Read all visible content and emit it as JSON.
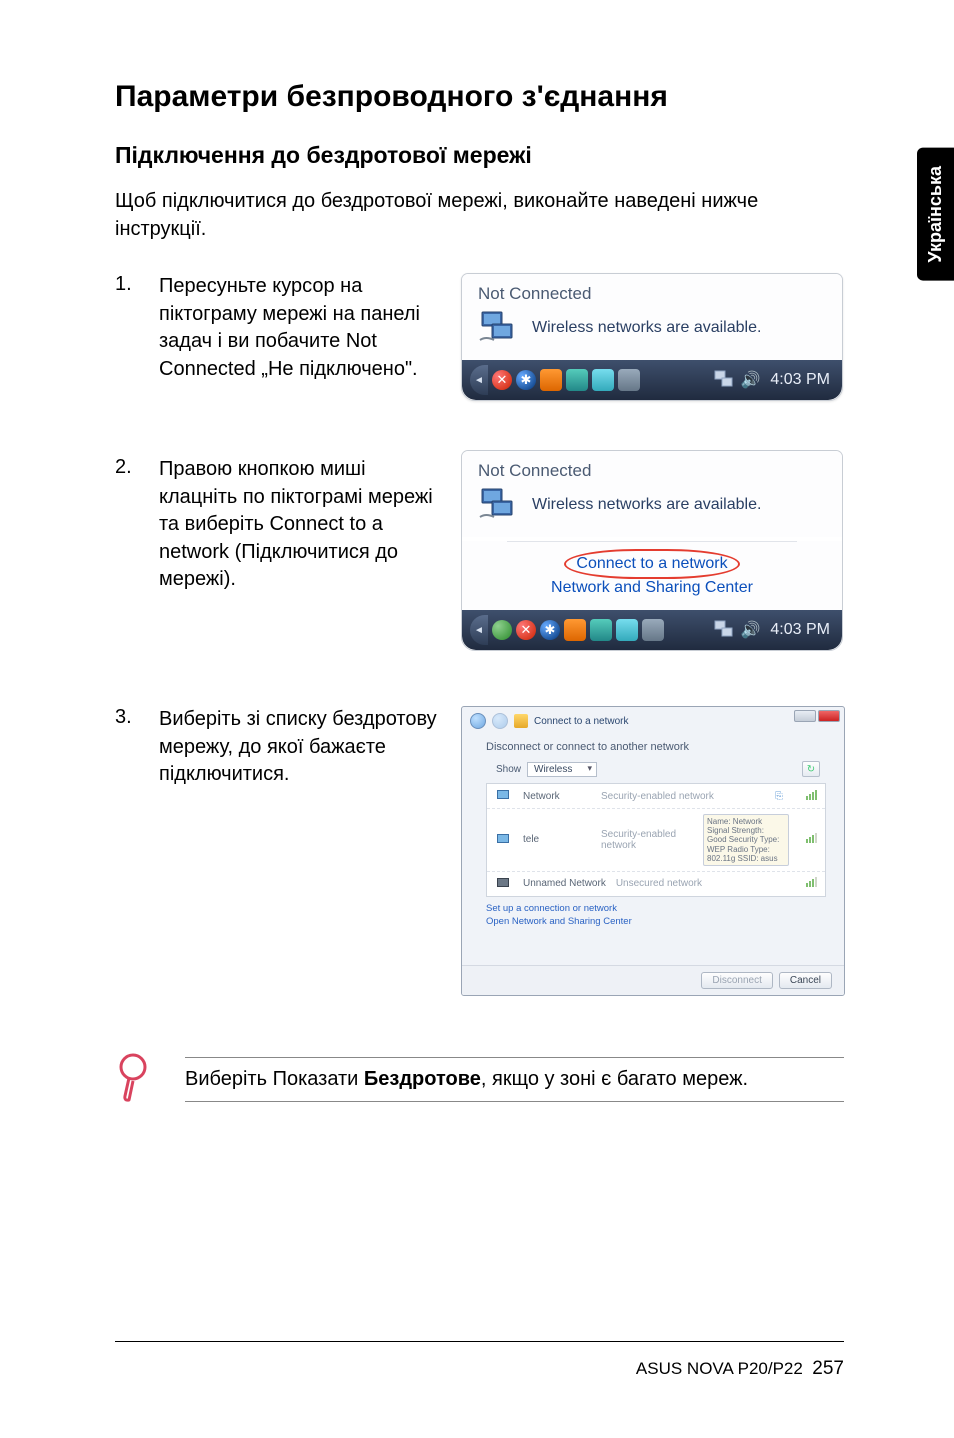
{
  "side_tab": "Українська",
  "heading": "Параметри безпроводного з'єднання",
  "subheading": "Підключення до бездротової мережі",
  "intro": "Щоб підключитися до бездротової мережі, виконайте наведені нижче інструкції.",
  "steps": {
    "one": {
      "num": "1.",
      "text": "Пересуньте курсор на піктограму мережі на панелі задач і ви побачите Not Connected „Не підключено\"."
    },
    "two": {
      "num": "2.",
      "text": "Правою кнопкою миші клацніть по піктограмі мережі та виберіть Connect to a network (Підключитися до мережі)."
    },
    "three": {
      "num": "3.",
      "text": "Виберіть зі списку бездротову мережу, до якої бажаєте підключитися."
    }
  },
  "shot1": {
    "title": "Not Connected",
    "msg": "Wireless networks are available.",
    "time": "4:03 PM"
  },
  "shot2": {
    "title": "Not Connected",
    "msg": "Wireless networks are available.",
    "ctx_connect": "Connect to a network",
    "ctx_sharing": "Network and Sharing Center",
    "time": "4:03 PM"
  },
  "shot3": {
    "hdr_title": "Connect to a network",
    "subhdr": "Disconnect or connect to another network",
    "show_label": "Show",
    "show_value": "Wireless",
    "rows": [
      {
        "name": "Network",
        "type": "Security-enabled network"
      },
      {
        "name": "tele",
        "type": "Security-enabled network",
        "tip": "Name: Network\nSignal Strength: Good\nSecurity Type: WEP\nRadio Type: 802.11g\nSSID: asus"
      },
      {
        "name": "Unnamed Network",
        "type": "Unsecured network"
      }
    ],
    "link1": "Set up a connection or network",
    "link2": "Open Network and Sharing Center",
    "btn_connect": "Disconnect",
    "btn_cancel": "Cancel"
  },
  "note": {
    "prefix": "Виберіть Показати ",
    "bold": "Бездротове",
    "suffix": ", якщо у зоні є багато мереж."
  },
  "footer": {
    "product": "ASUS NOVA P20/P22",
    "page": "257"
  }
}
